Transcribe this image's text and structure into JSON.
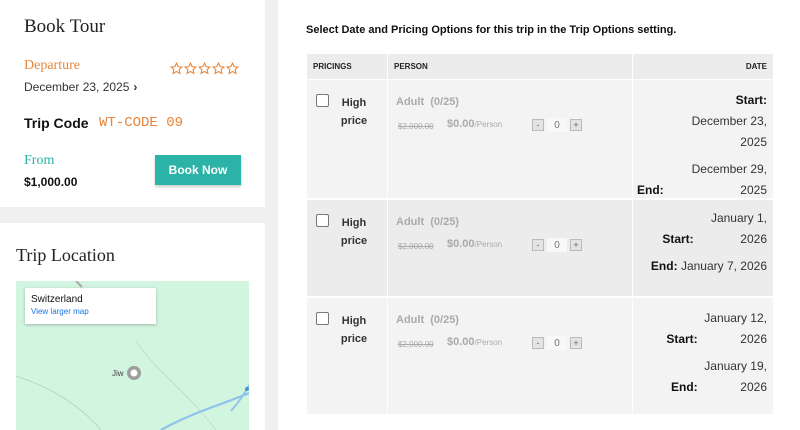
{
  "book_tour": {
    "title": "Book Tour",
    "departure_label": "Departure",
    "departure_date": "December 23, 2025",
    "rating_stars": 5,
    "trip_code_label": "Trip Code",
    "trip_code_value": "WT-CODE 09",
    "from_label": "From",
    "price": "$1,000.00",
    "book_button": "Book Now"
  },
  "trip_location": {
    "title": "Trip Location",
    "map_place": "Switzerland",
    "map_link": "View larger map",
    "map_marker_label": "Jiw"
  },
  "main": {
    "notice": "Select Date and Pricing Options for this trip in the Trip Options setting.",
    "headers": {
      "pricings": "PRICINGS",
      "person": "PERSON",
      "date": "DATE"
    },
    "rows": [
      {
        "pricing": "High price",
        "adult_label": "Adult",
        "capacity": "(0/25)",
        "old_price": "$2,000.00",
        "new_price": "$0.00",
        "per": "/Person",
        "qty": "0",
        "start_label": "Start:",
        "start_date": "December 23, 2025",
        "end_label": "End:",
        "end_date": "December 29, 2025"
      },
      {
        "pricing": "High price",
        "adult_label": "Adult",
        "capacity": "(0/25)",
        "old_price": "$2,000.00",
        "new_price": "$0.00",
        "per": "/Person",
        "qty": "0",
        "start_label": "Start:",
        "start_date": "January 1, 2026",
        "end_label": "End:",
        "end_date": "January 7, 2026"
      },
      {
        "pricing": "High price",
        "adult_label": "Adult",
        "capacity": "(0/25)",
        "old_price": "$2,000.00",
        "new_price": "$0.00",
        "per": "/Person",
        "qty": "0",
        "start_label": "Start:",
        "start_date": "January 12, 2026",
        "end_label": "End:",
        "end_date": "January 19, 2026"
      }
    ],
    "stepper_minus": "-",
    "stepper_plus": "+"
  },
  "colors": {
    "accent_orange": "#e7853a",
    "accent_teal": "#2ab3a6",
    "map_bg": "#d1f5df"
  }
}
